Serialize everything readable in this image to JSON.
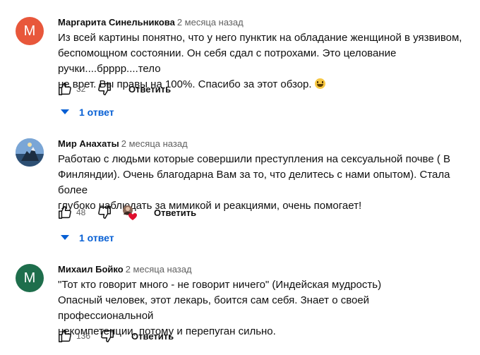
{
  "comments": [
    {
      "avatar_letter": "М",
      "avatar_color": "#e8573b",
      "author": "Маргарита Синельникова",
      "time": "2 месяца назад",
      "lines": [
        "Из всей картины понятно, что у него пунктик на обладание женщиной в уязвивом,",
        "беспомощном состоянии. Он себя сдал с потрохами. Это целование ручки....брррр....тело",
        "не врет. Вы правы на 100%. Спасибо за этот обзор."
      ],
      "likes": "32",
      "reply_label": "Ответить",
      "replies_label": "1 ответ"
    },
    {
      "author": "Мир Анахаты",
      "time": "2 месяца назад",
      "lines": [
        "Работаю с людьми которые совершили преступления на сексуальной почве ( В",
        "Финляндии). Очень благодарна Вам за то, что делитесь с нами опытом). Стала более",
        "глубоко наблюдать за мимикой и реакциями, очень помогает!"
      ],
      "likes": "48",
      "reply_label": "Ответить",
      "replies_label": "1 ответ"
    },
    {
      "avatar_letter": "М",
      "avatar_color": "#1e6e4c",
      "author": "Михаил Бойко",
      "time": "2 месяца назад",
      "lines": [
        "\"Тот кто говорит много - не говорит ничего\" (Индейская мудрость)",
        "Опасный человек, этот лекарь, боится сам себя. Знает о своей профессиональной",
        "некомпетенции, потому и перепуган сильно."
      ],
      "likes": "136",
      "reply_label": "Ответить"
    }
  ],
  "colors": {
    "link_blue": "#065fd4",
    "heart_red": "#e0102e"
  },
  "icons": [
    "thumb-up-icon",
    "thumb-down-icon",
    "chevron-down-icon",
    "creator-heart-icon",
    "smile-emoji-icon"
  ]
}
